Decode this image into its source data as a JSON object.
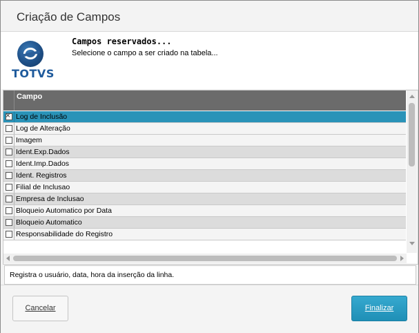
{
  "window": {
    "title": "Criação de Campos"
  },
  "header": {
    "logo_text": "TOTVS",
    "title": "Campos reservados...",
    "subtitle": "Selecione o campo a ser criado na tabela..."
  },
  "grid": {
    "column_header": "Campo",
    "rows": [
      {
        "label": "Log de Inclusão",
        "checked": true,
        "selected": true
      },
      {
        "label": "Log de Alteração",
        "checked": false
      },
      {
        "label": "Imagem",
        "checked": false
      },
      {
        "label": "Ident.Exp.Dados",
        "checked": false
      },
      {
        "label": "Ident.Imp.Dados",
        "checked": false
      },
      {
        "label": "Ident. Registros",
        "checked": false
      },
      {
        "label": "Filial de Inclusao",
        "checked": false
      },
      {
        "label": "Empresa de Inclusao",
        "checked": false
      },
      {
        "label": "Bloqueio Automatico por Data",
        "checked": false
      },
      {
        "label": "Bloqueio Automatico",
        "checked": false
      },
      {
        "label": "Responsabilidade do Registro",
        "checked": false
      }
    ]
  },
  "description": "Registra o usuário, data, hora da inserção da linha.",
  "buttons": {
    "cancel": "Cancelar",
    "finish": "Finalizar"
  },
  "colors": {
    "selected_row": "#2a93b8",
    "finish_button": "#2a9cc3",
    "grid_header": "#6b6b6b"
  }
}
